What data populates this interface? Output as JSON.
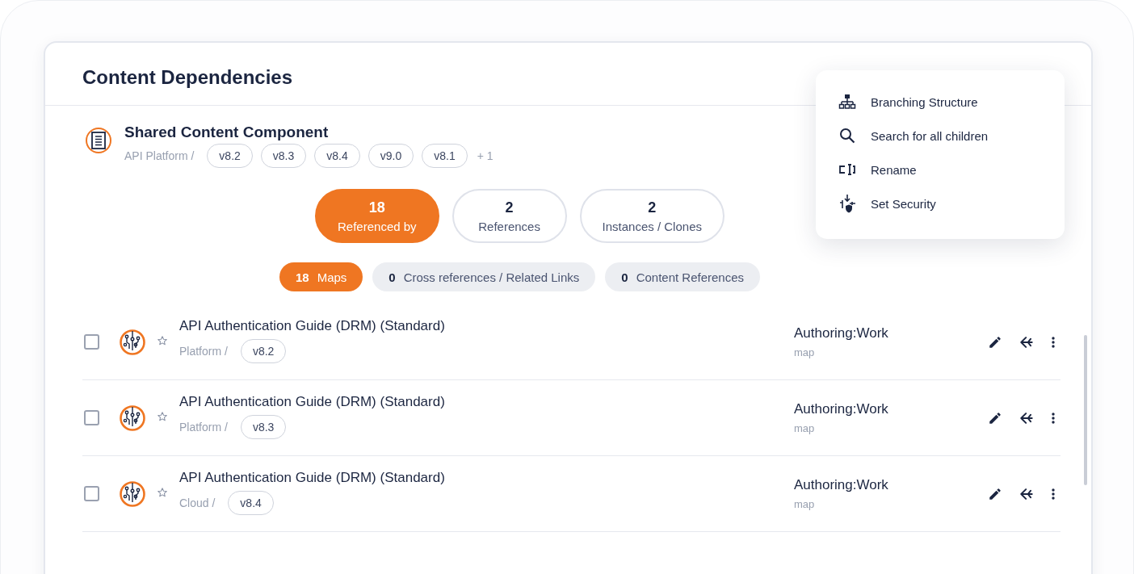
{
  "panel": {
    "title": "Content Dependencies"
  },
  "component": {
    "name": "Shared Content Component",
    "path": "API Platform /",
    "versions": [
      "v8.2",
      "v8.3",
      "v8.4",
      "v9.0",
      "v8.1"
    ],
    "more": "+ 1"
  },
  "tabs": [
    {
      "count": "18",
      "label": "Referenced by",
      "selected": true
    },
    {
      "count": "2",
      "label": "References",
      "selected": false
    },
    {
      "count": "2",
      "label": "Instances / Clones",
      "selected": false
    }
  ],
  "filters": [
    {
      "count": "18",
      "label": "Maps",
      "selected": true
    },
    {
      "count": "0",
      "label": "Cross references / Related Links",
      "selected": false
    },
    {
      "count": "0",
      "label": "Content References",
      "selected": false
    }
  ],
  "rows": [
    {
      "title": "API Authentication Guide (DRM) (Standard)",
      "path": "Platform /",
      "version": "v8.2",
      "status": "Authoring:Work",
      "type": "map",
      "checked": false,
      "starred": false
    },
    {
      "title": "API Authentication Guide (DRM) (Standard)",
      "path": "Platform /",
      "version": "v8.3",
      "status": "Authoring:Work",
      "type": "map",
      "checked": false,
      "starred": false
    },
    {
      "title": "API Authentication Guide (DRM) (Standard)",
      "path": "Cloud /",
      "version": "v8.4",
      "status": "Authoring:Work",
      "type": "map",
      "checked": false,
      "starred": false
    }
  ],
  "menu": [
    {
      "kind": "branch",
      "label": "Branching Structure"
    },
    {
      "kind": "search",
      "label": "Search for all children"
    },
    {
      "kind": "rename",
      "label": "Rename"
    },
    {
      "kind": "security",
      "label": "Set Security"
    }
  ]
}
